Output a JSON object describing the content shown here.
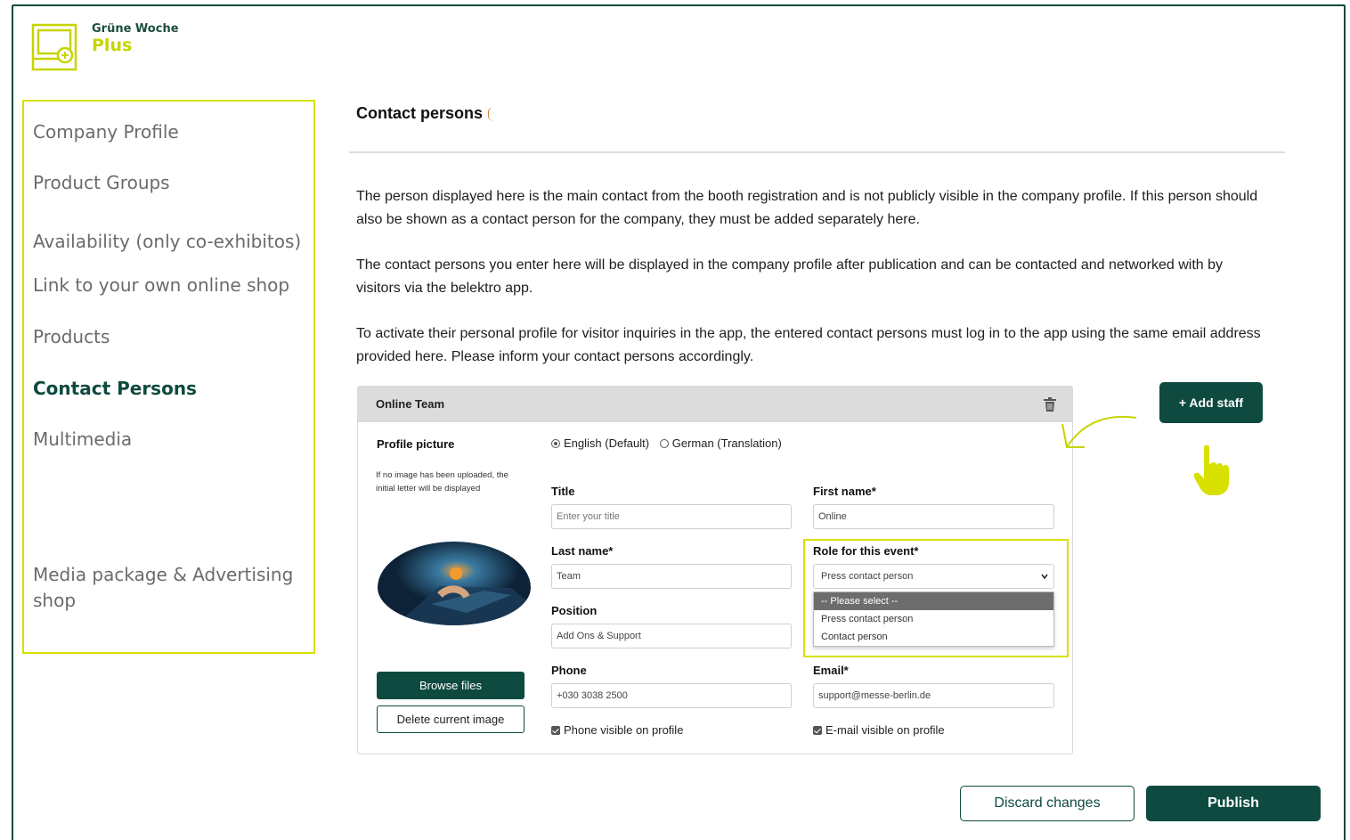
{
  "brand": {
    "line1": "Grüne Woche",
    "line2": "Plus",
    "accent": "#c7d400",
    "primary": "#0e4a3f"
  },
  "sidebar": {
    "items": [
      {
        "label": "Company Profile"
      },
      {
        "label": "Product Groups"
      },
      {
        "label": "Availability (only co-exhibitos)"
      },
      {
        "label": "Link to your own online shop"
      },
      {
        "label": "Products"
      },
      {
        "label": "Contact Persons",
        "active": true
      },
      {
        "label": "Multimedia"
      },
      {
        "label": "Media package & Advertising shop"
      }
    ]
  },
  "main": {
    "title": "Contact persons",
    "paragraphs": [
      "The person displayed here is the main contact from the booth registration and is not publicly visible in the company profile. If this person should also be shown as a contact person for the company, they must be added separately here.",
      "The contact persons you enter here will be displayed in the company profile after publication and can be contacted and networked with by visitors via the belektro app.",
      "To activate their personal profile for visitor inquiries in the app, the entered contact persons must log in to the app using the same email address provided here. Please inform your contact persons accordingly."
    ],
    "add_staff_label": "+ Add staff"
  },
  "card": {
    "header": "Online Team",
    "profile_picture_label": "Profile picture",
    "profile_note": "If no image has been uploaded, the initial letter will be displayed",
    "languages": [
      "English (Default)",
      "German (Translation)"
    ],
    "title_label": "Title",
    "title_placeholder": "Enter your title",
    "first_name_label": "First name*",
    "first_name_value": "Online",
    "last_name_label": "Last name*",
    "last_name_value": "Team",
    "role_label": "Role for this event*",
    "role_value": "Press contact person",
    "role_options": [
      "-- Please select --",
      "Press contact person",
      "Contact person"
    ],
    "position_label": "Position",
    "position_value": "Add Ons & Support",
    "phone_label": "Phone",
    "phone_value": "+030 3038 2500",
    "email_label": "Email*",
    "email_value": "support@messe-berlin.de",
    "phone_visible_label": "Phone visible on profile",
    "email_visible_label": "E-mail visible on profile",
    "browse_label": "Browse files",
    "delete_label": "Delete current image"
  },
  "footer": {
    "discard_label": "Discard changes",
    "publish_label": "Publish"
  }
}
